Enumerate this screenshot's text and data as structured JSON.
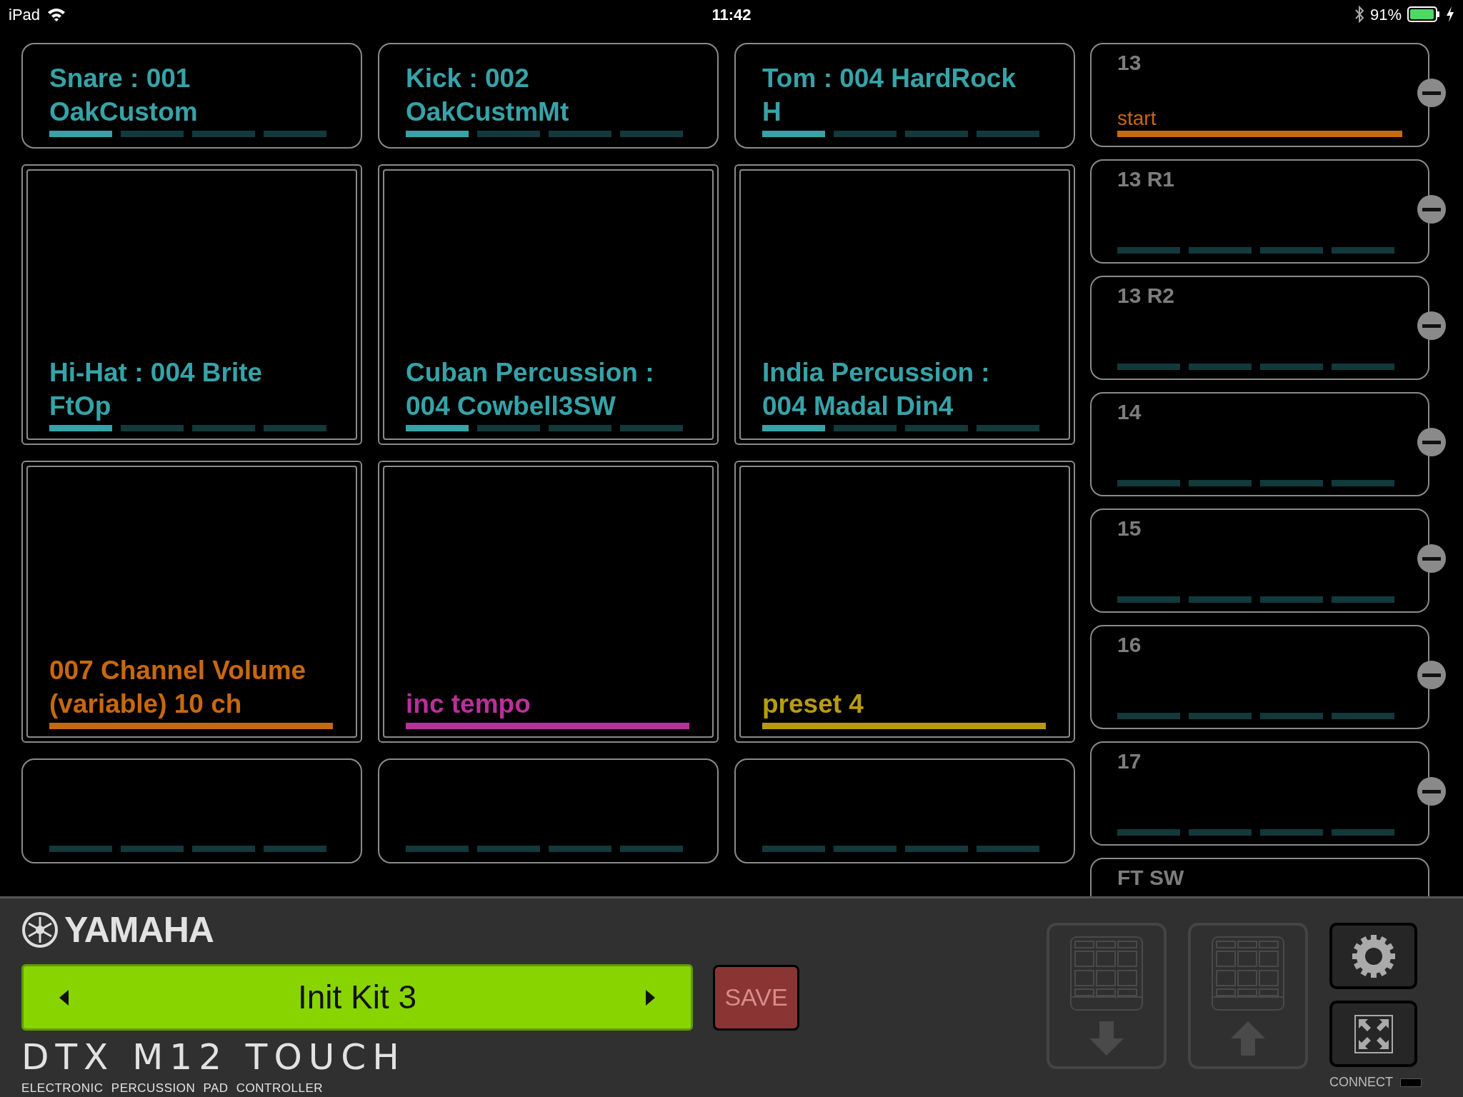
{
  "status_bar": {
    "device": "iPad",
    "time": "11:42",
    "battery": "91%"
  },
  "pad_rows": [
    [
      {
        "kind": "voice",
        "label": "Snare : 001 OakCustom",
        "layers": [
          true,
          false,
          false,
          false
        ]
      },
      {
        "kind": "voice",
        "label": "Kick : 002 OakCustmMt",
        "layers": [
          true,
          false,
          false,
          false
        ]
      },
      {
        "kind": "voice",
        "label": "Tom : 004 HardRock H",
        "layers": [
          true,
          false,
          false,
          false
        ]
      }
    ],
    [
      {
        "kind": "voice",
        "label": "Hi-Hat : 004 Brite FtOp",
        "layers": [
          true,
          false,
          false,
          false
        ]
      },
      {
        "kind": "voice",
        "label": "Cuban Percussion : 004 Cowbell3SW",
        "layers": [
          true,
          false,
          false,
          false
        ]
      },
      {
        "kind": "voice",
        "label": "India Percussion : 004 Madal Din4",
        "layers": [
          true,
          false,
          false,
          false
        ]
      }
    ],
    [
      {
        "kind": "function",
        "label": "007 Channel Volume (variable) 10 ch",
        "color": "#c8680f"
      },
      {
        "kind": "function",
        "label": "inc tempo",
        "color": "#b8309a"
      },
      {
        "kind": "function",
        "label": "preset 4",
        "color": "#b89c10"
      }
    ],
    [
      {
        "kind": "voice",
        "layers": [
          false,
          false,
          false,
          false
        ]
      },
      {
        "kind": "voice",
        "layers": [
          false,
          false,
          false,
          false
        ]
      },
      {
        "kind": "voice",
        "layers": [
          false,
          false,
          false,
          false
        ]
      }
    ]
  ],
  "pad_slots": [
    {
      "kind": "function",
      "label": "13",
      "assignment": "start",
      "color": "#c8680f"
    },
    {
      "kind": "voice",
      "label": "13 R1",
      "layers": [
        false,
        false,
        false,
        false
      ]
    },
    {
      "kind": "voice",
      "label": "13 R2",
      "layers": [
        false,
        false,
        false,
        false
      ]
    },
    {
      "kind": "voice",
      "label": "14",
      "layers": [
        false,
        false,
        false,
        false
      ]
    },
    {
      "kind": "voice",
      "label": "15",
      "layers": [
        false,
        false,
        false,
        false
      ]
    },
    {
      "kind": "voice",
      "label": "16",
      "layers": [
        false,
        false,
        false,
        false
      ]
    },
    {
      "kind": "voice",
      "label": "17",
      "layers": [
        false,
        false,
        false,
        false
      ]
    },
    {
      "kind": "voice",
      "label": "FT SW"
    }
  ],
  "brand": "YAMAHA",
  "kit": {
    "name": "Init Kit 3"
  },
  "save_button": "SAVE",
  "product": {
    "title": "DTX M12 TOUCH",
    "subtitle": "ELECTRONIC PERCUSSION PAD CONTROLLER"
  },
  "transfer_buttons": [
    {
      "kind": "download",
      "disabled": true
    },
    {
      "kind": "upload",
      "disabled": true
    }
  ],
  "connect": {
    "label": "CONNECT",
    "on": false
  }
}
